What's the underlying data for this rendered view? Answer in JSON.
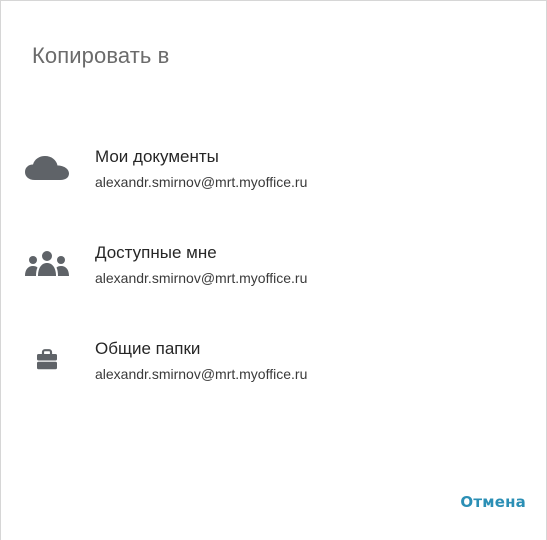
{
  "dialog": {
    "title": "Копировать в",
    "items": [
      {
        "icon": "cloud-icon",
        "name": "Мои документы",
        "email": "alexandr.smirnov@mrt.myoffice.ru"
      },
      {
        "icon": "people-icon",
        "name": "Доступные мне",
        "email": "alexandr.smirnov@mrt.myoffice.ru"
      },
      {
        "icon": "briefcase-icon",
        "name": "Общие папки",
        "email": "alexandr.smirnov@mrt.myoffice.ru"
      }
    ],
    "cancel_label": "Отмена"
  },
  "colors": {
    "accent": "#2b8fb5",
    "icon": "#5f6368",
    "title": "#6b6b6b"
  }
}
